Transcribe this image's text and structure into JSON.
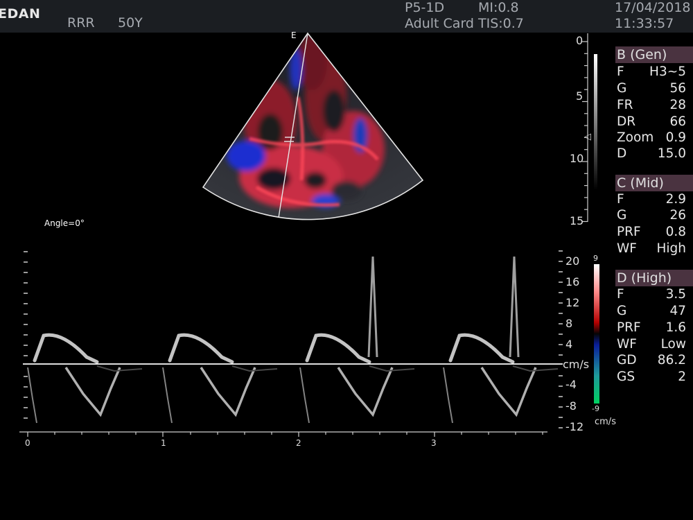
{
  "header": {
    "logo": "EDAN",
    "patient_id": "RRR",
    "patient_age": "50Y",
    "probe": "P5-1D",
    "exam": "Adult Card",
    "mi": "MI:0.8",
    "tis": "TIS:0.7",
    "date": "17/04/2018",
    "time": "11:33:57"
  },
  "bmode": {
    "sector_label": "E",
    "depth_ticks": [
      "0",
      "5",
      "10",
      "15"
    ],
    "focus_marker": "◁"
  },
  "angle_text": "Angle=0°",
  "params": {
    "b": {
      "title": "B (Gen)",
      "rows": [
        {
          "k": "F",
          "v": "H3~5"
        },
        {
          "k": "G",
          "v": "56"
        },
        {
          "k": "FR",
          "v": "28"
        },
        {
          "k": "DR",
          "v": "66"
        },
        {
          "k": "Zoom",
          "v": "0.9"
        },
        {
          "k": "D",
          "v": "15.0"
        }
      ]
    },
    "c": {
      "title": "C (Mid)",
      "rows": [
        {
          "k": "F",
          "v": "2.9"
        },
        {
          "k": "G",
          "v": "26"
        },
        {
          "k": "PRF",
          "v": "0.8"
        },
        {
          "k": "WF",
          "v": "High"
        }
      ]
    },
    "d": {
      "title": "D (High)",
      "rows": [
        {
          "k": "F",
          "v": "3.5"
        },
        {
          "k": "G",
          "v": "47"
        },
        {
          "k": "PRF",
          "v": "1.6"
        },
        {
          "k": "WF",
          "v": "Low"
        },
        {
          "k": "GD",
          "v": "86.2"
        },
        {
          "k": "GS",
          "v": "2"
        }
      ]
    }
  },
  "color_bar": {
    "top": "9",
    "bottom": "-9",
    "unit": "cm/s"
  },
  "doppler": {
    "velocity_ticks": [
      "20",
      "16",
      "12",
      "8",
      "4",
      "cm/s",
      "-4",
      "-8",
      "-12"
    ],
    "time_ticks": [
      "0",
      "1",
      "2",
      "3"
    ]
  },
  "colors": {
    "header_bg": "#1b1e22",
    "title_bg": "#4a3340",
    "baseline": "#ffffff"
  }
}
